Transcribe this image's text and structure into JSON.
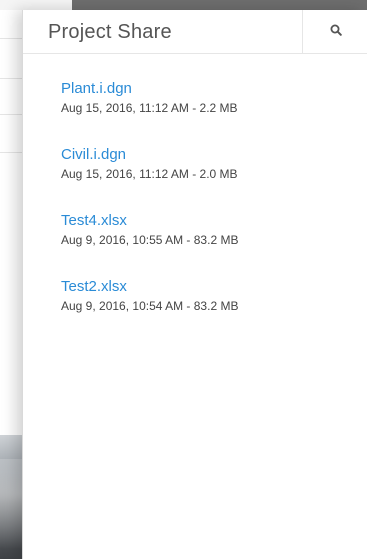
{
  "panel": {
    "title": "Project Share",
    "search_icon": "search-icon"
  },
  "files": [
    {
      "name": "Plant.i.dgn",
      "meta": "Aug 15, 2016, 11:12 AM - 2.2 MB"
    },
    {
      "name": "Civil.i.dgn",
      "meta": "Aug 15, 2016, 11:12 AM - 2.0 MB"
    },
    {
      "name": "Test4.xlsx",
      "meta": "Aug 9, 2016, 10:55 AM - 83.2 MB"
    },
    {
      "name": "Test2.xlsx",
      "meta": "Aug 9, 2016, 10:54 AM - 83.2 MB"
    }
  ],
  "colors": {
    "link": "#2a8bd6",
    "title": "#555555",
    "meta": "#444444"
  }
}
